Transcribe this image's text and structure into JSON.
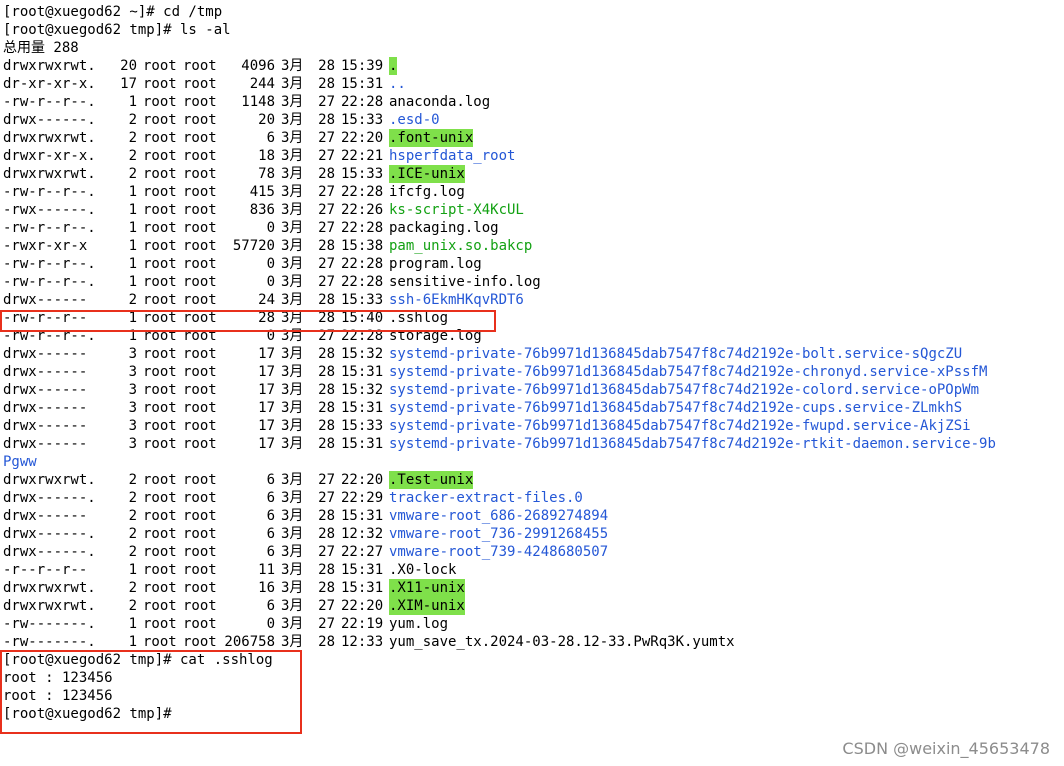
{
  "prompts": {
    "p1": "[root@xuegod62 ~]# cd /tmp",
    "p2": "[root@xuegod62 tmp]# ls -al",
    "total": "总用量 288",
    "p3": "[root@xuegod62 tmp]# cat .sshlog",
    "out1": "root : 123456",
    "out2": "root : 123456",
    "p4": "[root@xuegod62 tmp]# "
  },
  "listing": [
    {
      "perm": "drwxrwxrwt.",
      "links": "20",
      "owner": "root",
      "group": "root",
      "size": "4096",
      "month": "3月",
      "day": "28",
      "time": "15:39",
      "name": ".",
      "kind": "sticky"
    },
    {
      "perm": "dr-xr-xr-x.",
      "links": "17",
      "owner": "root",
      "group": "root",
      "size": "244",
      "month": "3月",
      "day": "28",
      "time": "15:31",
      "name": "..",
      "kind": "dir"
    },
    {
      "perm": "-rw-r--r--.",
      "links": "1",
      "owner": "root",
      "group": "root",
      "size": "1148",
      "month": "3月",
      "day": "27",
      "time": "22:28",
      "name": "anaconda.log",
      "kind": "plain"
    },
    {
      "perm": "drwx------.",
      "links": "2",
      "owner": "root",
      "group": "root",
      "size": "20",
      "month": "3月",
      "day": "28",
      "time": "15:33",
      "name": ".esd-0",
      "kind": "dir"
    },
    {
      "perm": "drwxrwxrwt.",
      "links": "2",
      "owner": "root",
      "group": "root",
      "size": "6",
      "month": "3月",
      "day": "27",
      "time": "22:20",
      "name": ".font-unix",
      "kind": "sticky"
    },
    {
      "perm": "drwxr-xr-x.",
      "links": "2",
      "owner": "root",
      "group": "root",
      "size": "18",
      "month": "3月",
      "day": "27",
      "time": "22:21",
      "name": "hsperfdata_root",
      "kind": "dir"
    },
    {
      "perm": "drwxrwxrwt.",
      "links": "2",
      "owner": "root",
      "group": "root",
      "size": "78",
      "month": "3月",
      "day": "28",
      "time": "15:33",
      "name": ".ICE-unix",
      "kind": "sticky"
    },
    {
      "perm": "-rw-r--r--.",
      "links": "1",
      "owner": "root",
      "group": "root",
      "size": "415",
      "month": "3月",
      "day": "27",
      "time": "22:28",
      "name": "ifcfg.log",
      "kind": "plain"
    },
    {
      "perm": "-rwx------.",
      "links": "1",
      "owner": "root",
      "group": "root",
      "size": "836",
      "month": "3月",
      "day": "27",
      "time": "22:26",
      "name": "ks-script-X4KcUL",
      "kind": "exe"
    },
    {
      "perm": "-rw-r--r--.",
      "links": "1",
      "owner": "root",
      "group": "root",
      "size": "0",
      "month": "3月",
      "day": "27",
      "time": "22:28",
      "name": "packaging.log",
      "kind": "plain"
    },
    {
      "perm": "-rwxr-xr-x",
      "links": "1",
      "owner": "root",
      "group": "root",
      "size": "57720",
      "month": "3月",
      "day": "28",
      "time": "15:38",
      "name": "pam_unix.so.bakcp",
      "kind": "exe"
    },
    {
      "perm": "-rw-r--r--.",
      "links": "1",
      "owner": "root",
      "group": "root",
      "size": "0",
      "month": "3月",
      "day": "27",
      "time": "22:28",
      "name": "program.log",
      "kind": "plain"
    },
    {
      "perm": "-rw-r--r--.",
      "links": "1",
      "owner": "root",
      "group": "root",
      "size": "0",
      "month": "3月",
      "day": "27",
      "time": "22:28",
      "name": "sensitive-info.log",
      "kind": "plain"
    },
    {
      "perm": "drwx------",
      "links": "2",
      "owner": "root",
      "group": "root",
      "size": "24",
      "month": "3月",
      "day": "28",
      "time": "15:33",
      "name": "ssh-6EkmHKqvRDT6",
      "kind": "dir"
    },
    {
      "perm": "-rw-r--r--",
      "links": "1",
      "owner": "root",
      "group": "root",
      "size": "28",
      "month": "3月",
      "day": "28",
      "time": "15:40",
      "name": ".sshlog",
      "kind": "plain"
    },
    {
      "perm": "-rw-r--r--.",
      "links": "1",
      "owner": "root",
      "group": "root",
      "size": "0",
      "month": "3月",
      "day": "27",
      "time": "22:28",
      "name": "storage.log",
      "kind": "plain"
    },
    {
      "perm": "drwx------",
      "links": "3",
      "owner": "root",
      "group": "root",
      "size": "17",
      "month": "3月",
      "day": "28",
      "time": "15:32",
      "name": "systemd-private-76b9971d136845dab7547f8c74d2192e-bolt.service-sQgcZU",
      "kind": "dir"
    },
    {
      "perm": "drwx------",
      "links": "3",
      "owner": "root",
      "group": "root",
      "size": "17",
      "month": "3月",
      "day": "28",
      "time": "15:31",
      "name": "systemd-private-76b9971d136845dab7547f8c74d2192e-chronyd.service-xPssfM",
      "kind": "dir"
    },
    {
      "perm": "drwx------",
      "links": "3",
      "owner": "root",
      "group": "root",
      "size": "17",
      "month": "3月",
      "day": "28",
      "time": "15:32",
      "name": "systemd-private-76b9971d136845dab7547f8c74d2192e-colord.service-oPOpWm",
      "kind": "dir"
    },
    {
      "perm": "drwx------",
      "links": "3",
      "owner": "root",
      "group": "root",
      "size": "17",
      "month": "3月",
      "day": "28",
      "time": "15:31",
      "name": "systemd-private-76b9971d136845dab7547f8c74d2192e-cups.service-ZLmkhS",
      "kind": "dir"
    },
    {
      "perm": "drwx------",
      "links": "3",
      "owner": "root",
      "group": "root",
      "size": "17",
      "month": "3月",
      "day": "28",
      "time": "15:33",
      "name": "systemd-private-76b9971d136845dab7547f8c74d2192e-fwupd.service-AkjZSi",
      "kind": "dir"
    },
    {
      "perm": "drwx------",
      "links": "3",
      "owner": "root",
      "group": "root",
      "size": "17",
      "month": "3月",
      "day": "28",
      "time": "15:31",
      "name": "systemd-private-76b9971d136845dab7547f8c74d2192e-rtkit-daemon.service-9b",
      "kind": "dir"
    }
  ],
  "wrap_text": "Pgww",
  "listing2": [
    {
      "perm": "drwxrwxrwt.",
      "links": "2",
      "owner": "root",
      "group": "root",
      "size": "6",
      "month": "3月",
      "day": "27",
      "time": "22:20",
      "name": ".Test-unix",
      "kind": "sticky"
    },
    {
      "perm": "drwx------.",
      "links": "2",
      "owner": "root",
      "group": "root",
      "size": "6",
      "month": "3月",
      "day": "27",
      "time": "22:29",
      "name": "tracker-extract-files.0",
      "kind": "dir"
    },
    {
      "perm": "drwx------",
      "links": "2",
      "owner": "root",
      "group": "root",
      "size": "6",
      "month": "3月",
      "day": "28",
      "time": "15:31",
      "name": "vmware-root_686-2689274894",
      "kind": "dir"
    },
    {
      "perm": "drwx------.",
      "links": "2",
      "owner": "root",
      "group": "root",
      "size": "6",
      "month": "3月",
      "day": "28",
      "time": "12:32",
      "name": "vmware-root_736-2991268455",
      "kind": "dir"
    },
    {
      "perm": "drwx------.",
      "links": "2",
      "owner": "root",
      "group": "root",
      "size": "6",
      "month": "3月",
      "day": "27",
      "time": "22:27",
      "name": "vmware-root_739-4248680507",
      "kind": "dir"
    },
    {
      "perm": "-r--r--r--",
      "links": "1",
      "owner": "root",
      "group": "root",
      "size": "11",
      "month": "3月",
      "day": "28",
      "time": "15:31",
      "name": ".X0-lock",
      "kind": "plain"
    },
    {
      "perm": "drwxrwxrwt.",
      "links": "2",
      "owner": "root",
      "group": "root",
      "size": "16",
      "month": "3月",
      "day": "28",
      "time": "15:31",
      "name": ".X11-unix",
      "kind": "sticky"
    },
    {
      "perm": "drwxrwxrwt.",
      "links": "2",
      "owner": "root",
      "group": "root",
      "size": "6",
      "month": "3月",
      "day": "27",
      "time": "22:20",
      "name": ".XIM-unix",
      "kind": "sticky"
    },
    {
      "perm": "-rw-------.",
      "links": "1",
      "owner": "root",
      "group": "root",
      "size": "0",
      "month": "3月",
      "day": "27",
      "time": "22:19",
      "name": "yum.log",
      "kind": "plain"
    },
    {
      "perm": "-rw-------.",
      "links": "1",
      "owner": "root",
      "group": "root",
      "size": "206758",
      "month": "3月",
      "day": "28",
      "time": "12:33",
      "name": "yum_save_tx.2024-03-28.12-33.PwRq3K.yumtx",
      "kind": "plain"
    }
  ],
  "watermark": "CSDN @weixin_45653478",
  "colors": {
    "directory": "#2457d6",
    "executable": "#13a113",
    "sticky_bg": "#7fe04a",
    "highlight_box": "#e8301c"
  }
}
